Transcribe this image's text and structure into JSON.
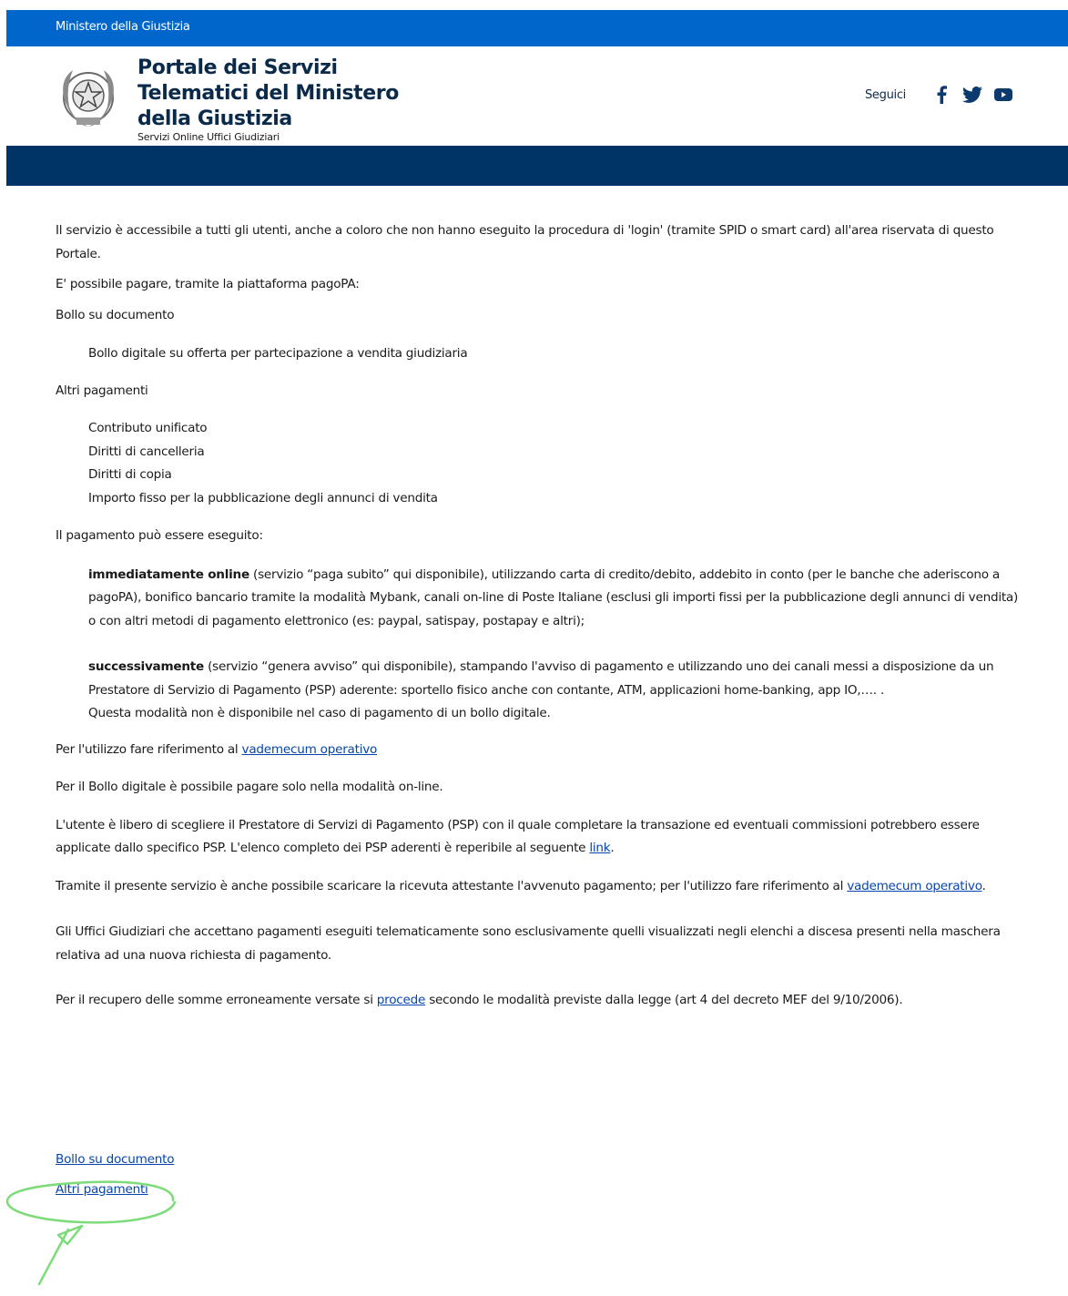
{
  "topbar": {
    "ministry": "Ministero della Giustizia"
  },
  "header": {
    "title_line1": "Portale dei Servizi",
    "title_line2": "Telematici del Ministero",
    "title_line3": "della Giustizia",
    "subtitle": "Servizi Online Uffici Giudiziari",
    "social_label": "Seguici",
    "social_icons": [
      "facebook-icon",
      "twitter-icon",
      "youtube-icon"
    ]
  },
  "content": {
    "intro": "Il servizio è accessibile a tutti gli utenti, anche a coloro che non hanno eseguito la procedura di 'login' (tramite SPID o smart card) all'area riservata di questo Portale.",
    "can_pay": "E' possibile pagare, tramite la piattaforma pagoPA:",
    "bollo_heading": "Bollo su documento",
    "bollo_item": "Bollo digitale su offerta per partecipazione a vendita giudiziaria",
    "altri_heading": "Altri pagamenti",
    "altri_items": [
      "Contributo unificato",
      "Diritti di cancelleria",
      "Diritti di copia",
      "Importo fisso per la pubblicazione degli annunci di vendita"
    ],
    "payment_can": "Il pagamento può essere eseguito:",
    "online_bold": "immediatamente online",
    "online_text": " (servizio “paga subito” qui disponibile), utilizzando carta di credito/debito, addebito in conto (per le banche che aderiscono a pagoPA), bonifico bancario tramite la modalità Mybank, canali on-line di Poste Italiane (esclusi gli importi fissi per la pubblicazione degli annunci di vendita) o con altri metodi di pagamento elettronico (es: paypal, satispay, postapay e altri);",
    "later_bold": "successivamente",
    "later_text": " (servizio “genera avviso” qui disponibile), stampando l'avviso di pagamento e utilizzando uno dei canali messi a disposizione da un Prestatore di Servizio di Pagamento (PSP) aderente: sportello fisico anche con contante, ATM, applicazioni home-banking, app IO,…. .",
    "later_note": "Questa modalità non è disponibile nel caso di pagamento di un bollo digitale.",
    "vademecum_pre": "Per l'utilizzo fare riferimento al ",
    "vademecum_link": "vademecum operativo",
    "bollo_online": "Per il Bollo digitale è possibile pagare solo nella modalità on-line.",
    "psp_text": "L'utente è libero di scegliere il Prestatore di Servizi di Pagamento (PSP) con il quale completare la transazione ed eventuali commissioni potrebbero essere applicate dallo specifico PSP. L'elenco completo dei PSP aderenti è reperibile al seguente ",
    "psp_link": "link",
    "psp_end": ".",
    "receipt_text": "Tramite il presente servizio è anche possibile scaricare la ricevuta attestante l'avvenuto pagamento; per l'utilizzo fare riferimento al ",
    "receipt_link": "vademecum operativo",
    "receipt_end": ".",
    "offices": "Gli Uffici Giudiziari che accettano pagamenti eseguiti telematicamente sono esclusivamente quelli visualizzati negli elenchi a discesa presenti nella maschera relativa ad una nuova richiesta di pagamento.",
    "refund_pre": "Per il recupero delle somme erroneamente versate si ",
    "refund_link": "procede",
    "refund_post": " secondo le modalità previste dalla legge (art 4 del decreto MEF del 9/10/2006)."
  },
  "bottom_links": {
    "bollo": "Bollo su documento",
    "altri": "Altri pagamenti"
  },
  "colors": {
    "topbar": "#0066cc",
    "navbar": "#003366",
    "link": "#0645ad",
    "annotation": "#7ddc7a"
  }
}
